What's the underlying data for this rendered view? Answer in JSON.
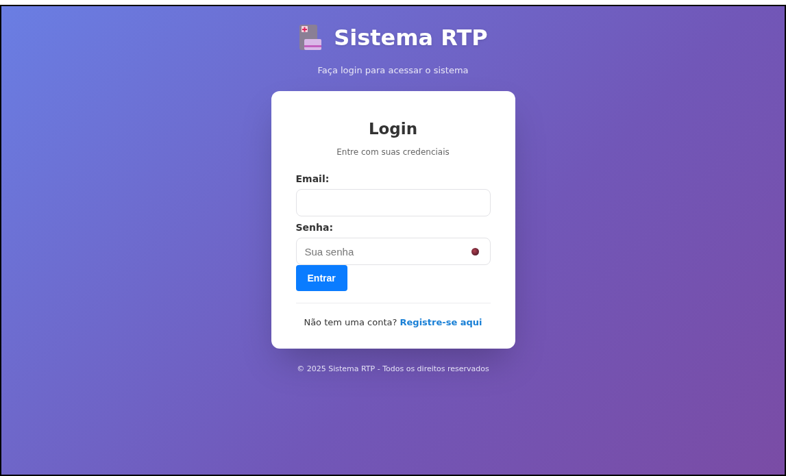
{
  "header": {
    "title": "Sistema RTP",
    "subtitle": "Faça login para acessar o sistema"
  },
  "card": {
    "title": "Login",
    "subtitle": "Entre com suas credenciais",
    "fields": [
      {
        "label": "Email:",
        "kind": "email"
      },
      {
        "label": "Senha:",
        "kind": "password",
        "placeholder": "Sua senha"
      }
    ],
    "submit": "Entrar",
    "register": {
      "text": "Não tem uma conta?",
      "link": "Registre-se aqui"
    }
  },
  "footer": "© 2025 Sistema RTP - Todos os direitos reservados"
}
